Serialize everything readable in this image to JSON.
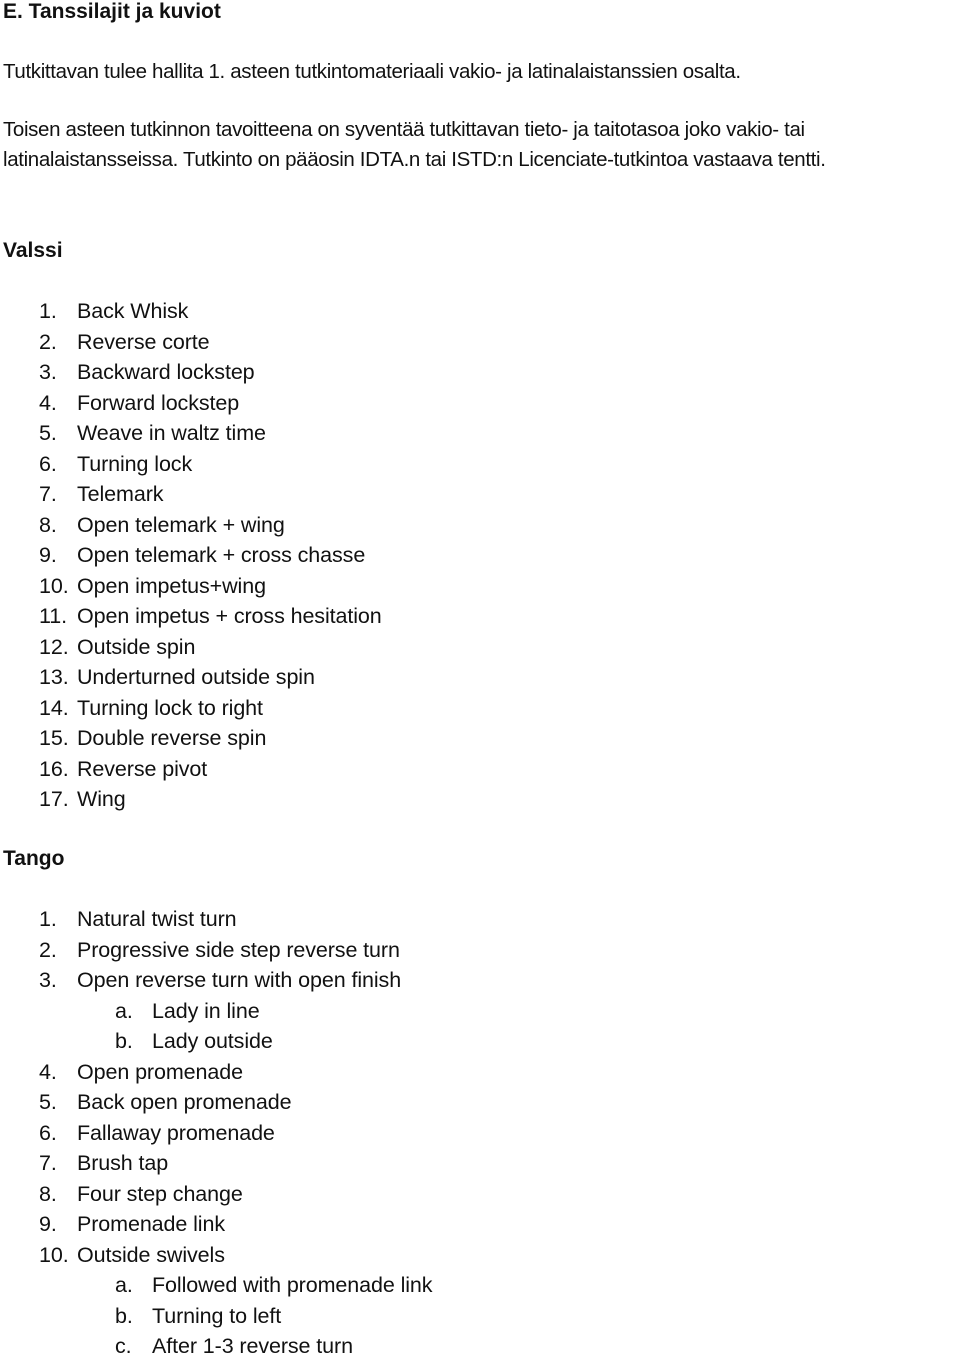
{
  "document": {
    "title": "E. Tanssilajit ja kuviot",
    "paragraphs": [
      "Tutkittavan tulee hallita 1. asteen tutkintomateriaali vakio- ja latinalaistanssien osalta.",
      "Toisen asteen tutkinnon tavoitteena on syventää tutkittavan tieto- ja taitotasoa joko vakio- tai",
      "latinalaistansseissa. Tutkinto on pääosin IDTA.n tai ISTD:n Licenciate-tutkintoa vastaava tentti."
    ],
    "sections": [
      {
        "heading": "Valssi",
        "items": [
          {
            "marker": "1.",
            "text": "Back Whisk"
          },
          {
            "marker": "2.",
            "text": "Reverse corte"
          },
          {
            "marker": "3.",
            "text": "Backward lockstep"
          },
          {
            "marker": "4.",
            "text": "Forward lockstep"
          },
          {
            "marker": "5.",
            "text": "Weave in waltz time"
          },
          {
            "marker": "6.",
            "text": "Turning lock"
          },
          {
            "marker": "7.",
            "text": "Telemark"
          },
          {
            "marker": "8.",
            "text": "Open telemark + wing"
          },
          {
            "marker": "9.",
            "text": "Open telemark + cross chasse"
          },
          {
            "marker": "10.",
            "text": "Open impetus+wing"
          },
          {
            "marker": "11.",
            "text": "Open impetus + cross hesitation"
          },
          {
            "marker": "12.",
            "text": "Outside spin"
          },
          {
            "marker": "13.",
            "text": "Underturned outside spin"
          },
          {
            "marker": "14.",
            "text": "Turning lock to right"
          },
          {
            "marker": "15.",
            "text": "Double reverse spin"
          },
          {
            "marker": "16.",
            "text": "Reverse pivot"
          },
          {
            "marker": "17.",
            "text": "Wing"
          }
        ]
      },
      {
        "heading": "Tango",
        "items": [
          {
            "marker": "1.",
            "text": "Natural twist turn"
          },
          {
            "marker": "2.",
            "text": "Progressive side step reverse turn"
          },
          {
            "marker": "3.",
            "text": "Open reverse turn with open finish"
          },
          {
            "marker": "a.",
            "text": "Lady in line",
            "sub": true
          },
          {
            "marker": "b.",
            "text": "Lady outside",
            "sub": true
          },
          {
            "marker": "4.",
            "text": "Open promenade"
          },
          {
            "marker": "5.",
            "text": "Back open promenade"
          },
          {
            "marker": "6.",
            "text": "Fallaway promenade"
          },
          {
            "marker": "7.",
            "text": "Brush tap"
          },
          {
            "marker": "8.",
            "text": "Four step change"
          },
          {
            "marker": "9.",
            "text": "Promenade link"
          },
          {
            "marker": "10.",
            "text": "Outside swivels"
          },
          {
            "marker": "a.",
            "text": "Followed with promenade link",
            "sub": true
          },
          {
            "marker": "b.",
            "text": "Turning to left",
            "sub": true
          },
          {
            "marker": "c.",
            "text": "After 1-3 reverse turn",
            "sub": true
          }
        ]
      }
    ]
  }
}
